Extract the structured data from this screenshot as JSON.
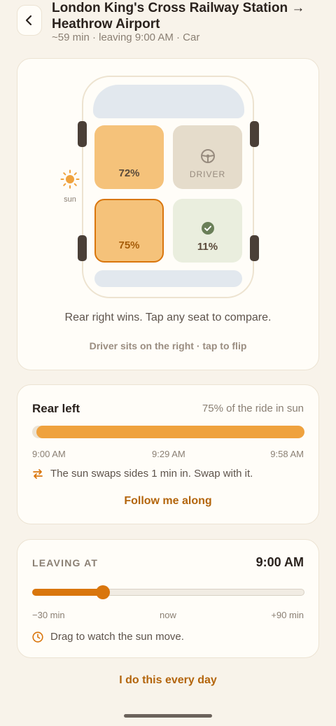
{
  "header": {
    "title": "London King's Cross Railway Station → Heathrow Airport",
    "subtitle": "~59 min · leaving 9:00 AM · Car"
  },
  "car": {
    "seats": {
      "front_left": {
        "pct": "72%"
      },
      "front_right": {
        "label": "DRIVER"
      },
      "rear_left": {
        "pct": "75%",
        "selected": true
      },
      "rear_right": {
        "pct": "11%",
        "best": true
      }
    },
    "sun_label": "sun",
    "verdict": "Rear right wins. Tap any seat to compare.",
    "flip_link": "Driver sits on the right · tap to flip"
  },
  "seat_detail": {
    "name": "Rear left",
    "sun_share": "75% of the ride in sun",
    "sun_fraction": 0.985,
    "times": [
      "9:00 AM",
      "9:29 AM",
      "9:58 AM"
    ],
    "swap_text": "The sun swaps sides 1 min in. Swap with it.",
    "follow_link": "Follow me along"
  },
  "departure": {
    "label": "LEAVING AT",
    "time": "9:00 AM",
    "slider_position": 0.26,
    "ticks": [
      "−30 min",
      "now",
      "+90 min"
    ],
    "hint": "Drag to watch the sun move."
  },
  "daily_link": "I do this every day",
  "colors": {
    "accent": "#d9760d",
    "sun_fill": "#efa23e",
    "seat_sun": "#f5c27a",
    "seat_driver": "#e5dccb",
    "seat_shade": "#eaeede",
    "check": "#6a7f58"
  },
  "icons": [
    "back-icon",
    "sun-icon",
    "steering-wheel-icon",
    "check-circle-icon",
    "swap-icon",
    "clock-icon"
  ]
}
